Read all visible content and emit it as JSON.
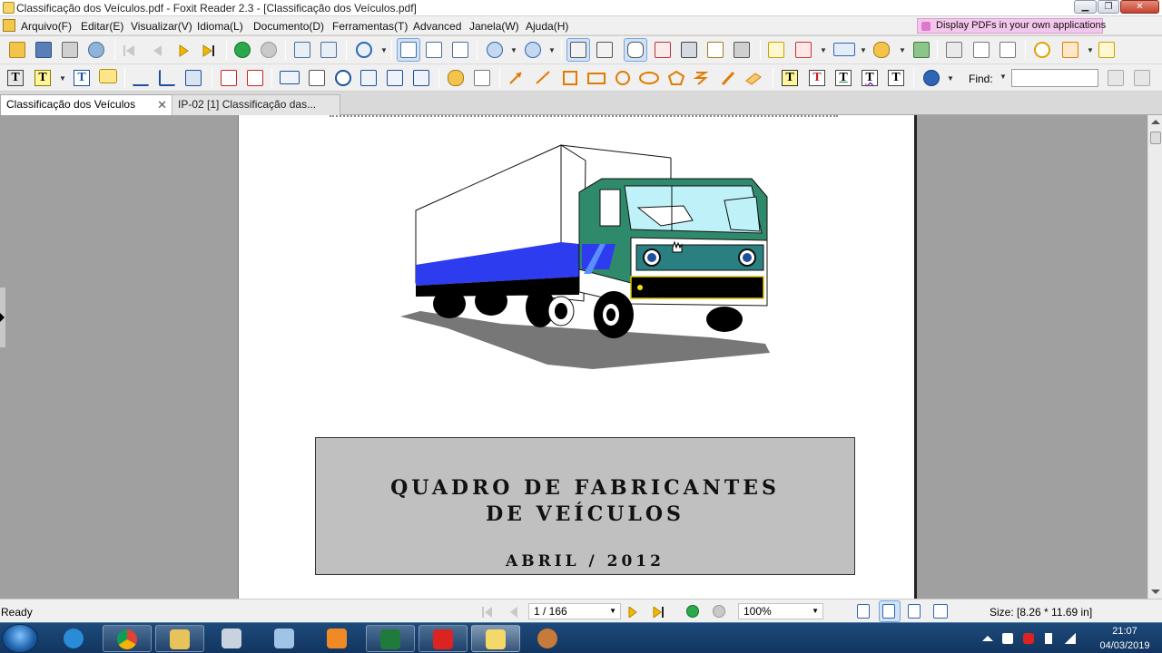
{
  "window": {
    "title": "Classificação dos Veículos.pdf - Foxit Reader 2.3 - [Classificação dos Veículos.pdf]",
    "minimize_label": "▁",
    "restore_label": "❐",
    "close_label": "✕"
  },
  "menu": {
    "items": [
      "Arquivo(F)",
      "Editar(E)",
      "Visualizar(V)",
      "Idioma(L)",
      "Documento(D)",
      "Ferramentas(T)",
      "Advanced",
      "Janela(W)",
      "Ajuda(H)"
    ],
    "promo": "Display PDFs in your own applications"
  },
  "toolbar": {
    "find_label": "Find:",
    "find_value": ""
  },
  "tabs": [
    {
      "label": "Classificação dos Veículos",
      "close": "✕"
    },
    {
      "label": "IP-02 [1] Classificação das..."
    }
  ],
  "document": {
    "title_line1": "QUADRO DE FABRICANTES",
    "title_line2": "DE VEÍCULOS",
    "date": "ABRIL / 2012"
  },
  "status": {
    "text": "Ready",
    "page": "1 / 166",
    "zoom": "100%",
    "size": "Size: [8.26 * 11.69 in]"
  },
  "taskbar": {
    "time": "21:07",
    "date": "04/03/2019",
    "apps": [
      "internet-explorer",
      "chrome",
      "file-explorer",
      "calculator",
      "notepad",
      "media-player",
      "excel",
      "acrobat",
      "foxit-reader",
      "mitt-app"
    ]
  }
}
